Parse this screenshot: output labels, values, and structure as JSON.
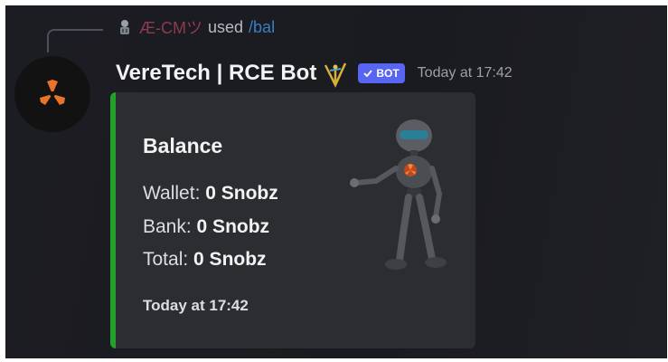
{
  "reply": {
    "username": "Æ-CMツ",
    "action": "used",
    "command": "/bal"
  },
  "message": {
    "author": "VereTech | RCE Bot",
    "bot_badge": "BOT",
    "timestamp": "Today at 17:42"
  },
  "embed": {
    "accent_color": "#23a12b",
    "title": "Balance",
    "fields": [
      {
        "label": "Wallet:",
        "value": "0 Snobz"
      },
      {
        "label": "Bank:",
        "value": "0 Snobz"
      },
      {
        "label": "Total:",
        "value": "0 Snobz"
      }
    ],
    "footer": "Today at 17:42"
  },
  "icons": {
    "avatar": "rce-logo-icon",
    "emoji": "gold-trident-emoji-icon",
    "badge_check": "check-icon",
    "thumbnail": "robot-image"
  }
}
